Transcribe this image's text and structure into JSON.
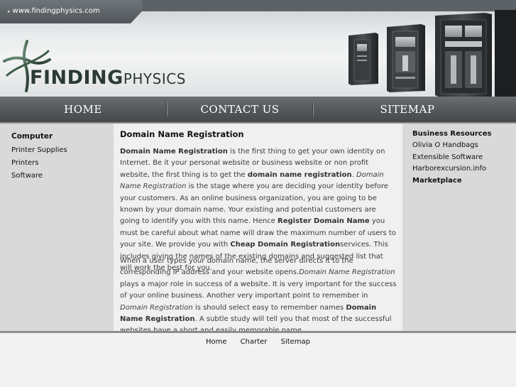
{
  "header": {
    "url": "www.findingphysics.com",
    "logo_big": "FINDING",
    "logo_small": "PHYSICS"
  },
  "nav": [
    {
      "label": "HOME"
    },
    {
      "label": "CONTACT US"
    },
    {
      "label": "SITEMAP"
    }
  ],
  "left": {
    "heading": "Computer",
    "links": [
      "Printer Supplies",
      "Printers",
      "Software"
    ]
  },
  "right": {
    "heading": "Business Resources",
    "links": [
      "Olivia O Handbags",
      "Extensible Software",
      "Harborexcursion.info"
    ],
    "heading2": "Marketplace"
  },
  "main": {
    "title": "Domain Name Registration",
    "p1": [
      {
        "t": "Domain Name Registration",
        "s": "b"
      },
      {
        "t": " is the first thing to get your own identity on Internet. Be it your personal website or business website or non profit website, the first thing is to get the ",
        "s": ""
      },
      {
        "t": "domain name registration",
        "s": "b"
      },
      {
        "t": ". ",
        "s": ""
      },
      {
        "t": "Domain Name Registration",
        "s": "i"
      },
      {
        "t": " is the stage where you are deciding your identity before your customers. As an online business organization, you are going to be known by your domain name. Your existing and potential customers are going to identify you with this name. Hence ",
        "s": ""
      },
      {
        "t": "Register Domain Name",
        "s": "b"
      },
      {
        "t": " you must be careful about what name will draw the maximum number of users to your site. We provide you with ",
        "s": ""
      },
      {
        "t": "Cheap Domain Registration",
        "s": "b"
      },
      {
        "t": "services. This includes giving the names of the existing domains and suggested list that will work the best for you.",
        "s": ""
      }
    ],
    "p2": [
      {
        "t": "When a user types your domain name, the server directs it to the corresponding IP address and your website opens.",
        "s": ""
      },
      {
        "t": "Domain Name Registration",
        "s": "i"
      },
      {
        "t": " plays a major role in success of a website. It is very important for the success of your online business. Another very important point to remember in ",
        "s": ""
      },
      {
        "t": "Domain Registration",
        "s": "i"
      },
      {
        "t": " is should select easy to remember names ",
        "s": ""
      },
      {
        "t": "Domain Name Registration",
        "s": "b"
      },
      {
        "t": ". A subtle study will tell you that most of the successful websites have a short and easily memorable name.",
        "s": ""
      }
    ]
  },
  "footer": {
    "links": [
      "Home",
      "Charter",
      "Sitemap"
    ]
  },
  "colors": {
    "nav_bg": "#575b5e",
    "side_bg": "#d9d9d9",
    "logo_green": "#2b3a32"
  }
}
